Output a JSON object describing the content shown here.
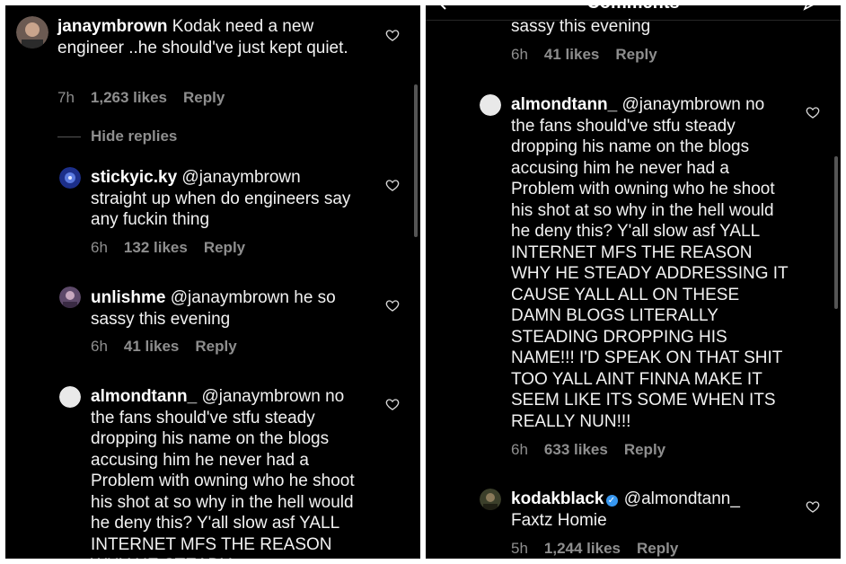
{
  "left_panel": {
    "comments": [
      {
        "username": "janaymbrown",
        "body": "Kodak need a new engineer ..he should've just kept quiet.",
        "time": "7h",
        "likes": "1,263 likes",
        "reply": "Reply"
      },
      {
        "username": "stickyic.ky",
        "body": "@janaymbrown straight up when do engineers say any fuckin thing",
        "time": "6h",
        "likes": "132 likes",
        "reply": "Reply"
      },
      {
        "username": "unlishme",
        "body": "@janaymbrown he so sassy this evening",
        "time": "6h",
        "likes": "41 likes",
        "reply": "Reply"
      },
      {
        "username": "almondtann_",
        "body": "@janaymbrown no the fans should've stfu steady dropping his name on the blogs accusing him he never had a Problem with owning who he shoot his shot at so why in the hell would he deny this? Y'all slow asf YALL INTERNET MFS THE REASON WHY HE STEADY"
      }
    ],
    "hide_replies": "Hide replies"
  },
  "right_panel": {
    "header_title": "Comments",
    "top_partial": {
      "body": "sassy this evening",
      "time": "6h",
      "likes": "41 likes",
      "reply": "Reply"
    },
    "comments": [
      {
        "username": "almondtann_",
        "body": "@janaymbrown no the fans should've stfu steady dropping his name on the blogs accusing him he never had a Problem with owning who he shoot his shot at so why in the hell would he deny this? Y'all slow asf YALL INTERNET MFS THE REASON WHY HE STEADY ADDRESSING IT CAUSE YALL ALL ON THESE DAMN BLOGS LITERALLY STEADING DROPPING HIS NAME!!! I'D SPEAK ON THAT SHIT TOO YALL AINT FINNA MAKE IT SEEM LIKE ITS SOME WHEN ITS REALLY NUN!!!",
        "time": "6h",
        "likes": "633 likes",
        "reply": "Reply"
      },
      {
        "username": "kodakblack",
        "verified": true,
        "body": "@almondtann_ Faxtz Homie",
        "time": "5h",
        "likes": "1,244 likes",
        "reply": "Reply"
      }
    ]
  },
  "colors": {
    "background": "#000000",
    "text": "#f2f2f2",
    "meta": "#8e8e8e",
    "verified": "#3797f0"
  }
}
